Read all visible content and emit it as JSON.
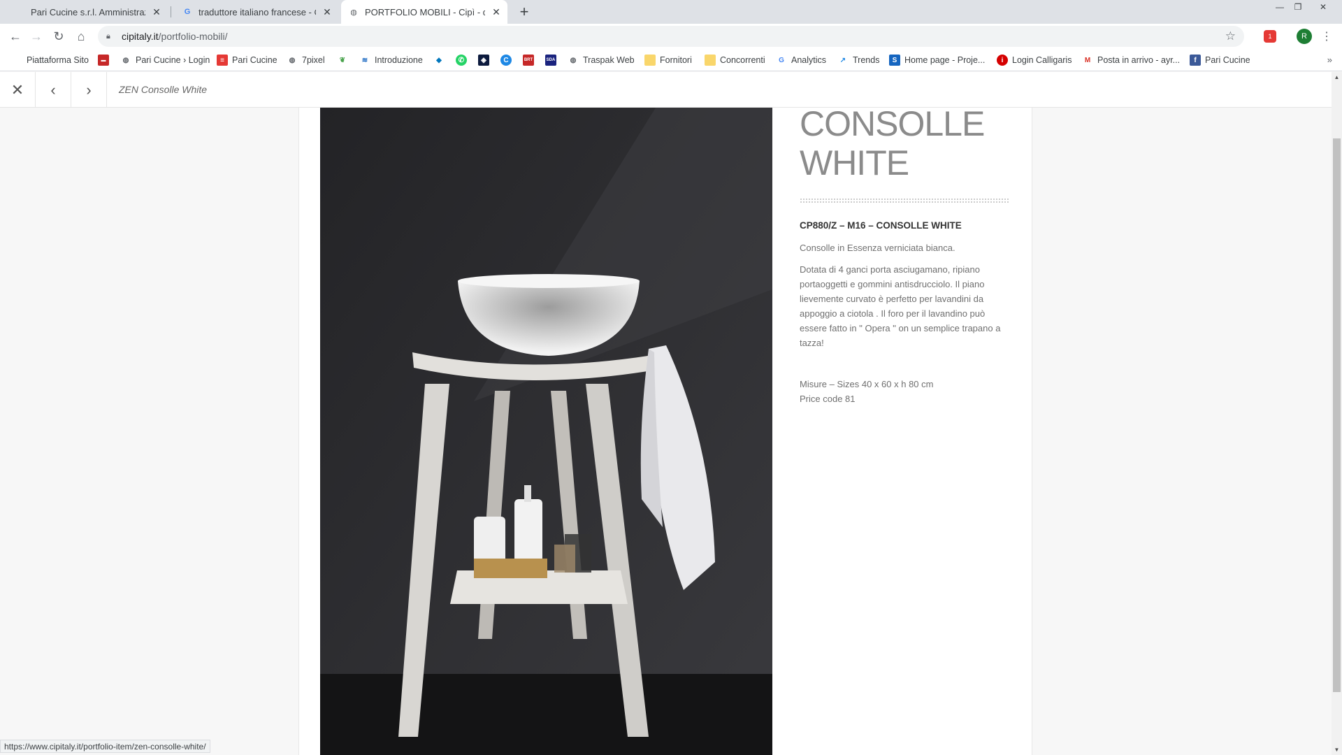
{
  "tabs": [
    {
      "title": "Pari Cucine s.r.l. Amministrazione",
      "active": false
    },
    {
      "title": "traduttore italiano francese - Cer",
      "active": false
    },
    {
      "title": "PORTFOLIO MOBILI - Cipì - desig",
      "active": true
    }
  ],
  "toolbar": {
    "url_host": "cipitaly.it",
    "url_path": "/portfolio-mobili/",
    "profile_initial": "R",
    "extension_badge": "1"
  },
  "bookmarks": [
    {
      "label": "Piattaforma Sito",
      "icon": "none"
    },
    {
      "label": "",
      "icon": "tyre-icon"
    },
    {
      "label": "Pari Cucine › Login",
      "icon": "globe-icon"
    },
    {
      "label": "Pari Cucine",
      "icon": "doc-icon"
    },
    {
      "label": "7pixel",
      "icon": "globe-icon"
    },
    {
      "label": "",
      "icon": "leaf-icon"
    },
    {
      "label": "Introduzione",
      "icon": "stack-icon"
    },
    {
      "label": "",
      "icon": "cube-icon"
    },
    {
      "label": "",
      "icon": "whatsapp-icon"
    },
    {
      "label": "",
      "icon": "dropbox-icon"
    },
    {
      "label": "",
      "icon": "c-icon"
    },
    {
      "label": "",
      "icon": "brt-icon"
    },
    {
      "label": "",
      "icon": "sda-icon"
    },
    {
      "label": "Traspak Web",
      "icon": "globe-icon"
    },
    {
      "label": "Fornitori",
      "icon": "folder-icon"
    },
    {
      "label": "Concorrenti",
      "icon": "folder-icon"
    },
    {
      "label": "Analytics",
      "icon": "google-icon"
    },
    {
      "label": "Trends",
      "icon": "trends-icon"
    },
    {
      "label": "Home page - Proje...",
      "icon": "s-icon"
    },
    {
      "label": "Login Calligaris",
      "icon": "calligaris-icon"
    },
    {
      "label": "Posta in arrivo - ayr...",
      "icon": "gmail-icon"
    },
    {
      "label": "Pari Cucine",
      "icon": "facebook-icon"
    }
  ],
  "lightbox": {
    "title": "ZEN Consolle White"
  },
  "product": {
    "heading_line1": "ZEN CONSOLLE",
    "heading_line2": "WHITE",
    "code": "CP880/Z – M16 – CONSOLLE WHITE",
    "description": "Consolle in Essenza verniciata bianca.",
    "details": "Dotata di 4 ganci porta asciugamano, ripiano portaoggetti e gommini antisdrucciolo. Il piano lievemente curvato è perfetto per lavandini da appoggio a ciotola . Il foro per il lavandino può essere fatto in \" Opera \" on un semplice trapano a tazza!",
    "sizes": "Misure – Sizes 40 x 60 x h 80 cm",
    "price": "Price code 81"
  },
  "status_url": "https://www.cipitaly.it/portfolio-item/zen-consolle-white/",
  "colors": {
    "tabstrip": "#dee1e6",
    "photo_bg": "#2b2b2d",
    "heading": "#8b8b8b"
  }
}
